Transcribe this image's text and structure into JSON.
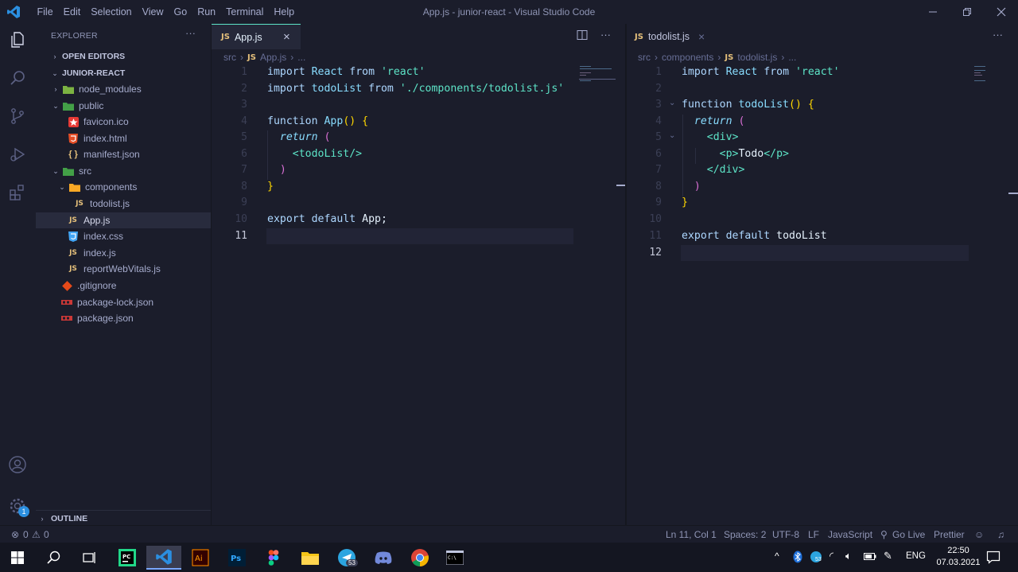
{
  "window": {
    "title": "App.js - junior-react - Visual Studio Code",
    "menu": [
      "File",
      "Edit",
      "Selection",
      "View",
      "Go",
      "Run",
      "Terminal",
      "Help"
    ]
  },
  "activity": {
    "icons": [
      "explorer-icon",
      "search-icon",
      "source-control-icon",
      "run-debug-icon",
      "extensions-icon",
      "account-icon",
      "manage-gear-icon"
    ],
    "manage_badge": "1"
  },
  "sidebar": {
    "title": "EXPLORER",
    "more": "···",
    "open_editors": "OPEN EDITORS",
    "project": "JUNIOR-REACT",
    "outline": "OUTLINE",
    "tree": [
      {
        "label": "node_modules",
        "type": "folder",
        "collapsed": true
      },
      {
        "label": "public",
        "type": "folder",
        "collapsed": false
      },
      {
        "label": "favicon.ico",
        "type": "file"
      },
      {
        "label": "index.html",
        "type": "file"
      },
      {
        "label": "manifest.json",
        "type": "file"
      },
      {
        "label": "src",
        "type": "folder",
        "collapsed": false
      },
      {
        "label": "components",
        "type": "folder",
        "collapsed": false
      },
      {
        "label": "todolist.js",
        "type": "file"
      },
      {
        "label": "App.js",
        "type": "file",
        "selected": true
      },
      {
        "label": "index.css",
        "type": "file"
      },
      {
        "label": "index.js",
        "type": "file"
      },
      {
        "label": "reportWebVitals.js",
        "type": "file"
      },
      {
        "label": ".gitignore",
        "type": "file"
      },
      {
        "label": "package-lock.json",
        "type": "file"
      },
      {
        "label": "package.json",
        "type": "file"
      }
    ]
  },
  "editor_left": {
    "tab_badge": "JS",
    "tab_label": "App.js",
    "close": "×",
    "more": "···",
    "breadcrumb": [
      "src",
      "›",
      "JS",
      "App.js",
      "›",
      "..."
    ],
    "line_numbers": [
      "1",
      "2",
      "3",
      "4",
      "5",
      "6",
      "7",
      "8",
      "9",
      "10",
      "11"
    ],
    "current_line": "11"
  },
  "editor_right": {
    "tab_badge": "JS",
    "tab_label": "todolist.js",
    "close": "×",
    "more": "···",
    "breadcrumb": [
      "src",
      "›",
      "components",
      "›",
      "JS",
      "todolist.js",
      "›",
      "..."
    ],
    "line_numbers": [
      "1",
      "2",
      "3",
      "4",
      "5",
      "6",
      "7",
      "8",
      "9",
      "10",
      "11",
      "12"
    ],
    "current_line": "12"
  },
  "statusbar": {
    "errors": "0",
    "warnings": "0",
    "position": "Ln 11, Col 1",
    "spaces": "Spaces: 2",
    "encoding": "UTF-8",
    "eol": "LF",
    "language": "JavaScript",
    "golive": "Go Live",
    "prettier": "Prettier"
  },
  "taskbar": {
    "apps": [
      "windows-start-icon",
      "search-icon",
      "task-view-icon",
      "pycharm-icon",
      "vscode-icon",
      "illustrator-icon",
      "photoshop-icon",
      "figma-icon",
      "file-explorer-icon",
      "telegram-icon",
      "discord-icon",
      "chrome-icon",
      "terminal-icon"
    ],
    "telegram_badge": "53",
    "tray_badge": "53",
    "lang": "ENG",
    "time": "22:50",
    "date": "07.03.2021"
  },
  "colors": {
    "accent": "#5de4c7",
    "background": "#1b1d2b",
    "text": "#a6accd",
    "brackets_gold": "#ffd700",
    "brackets_purple": "#da70d6"
  }
}
